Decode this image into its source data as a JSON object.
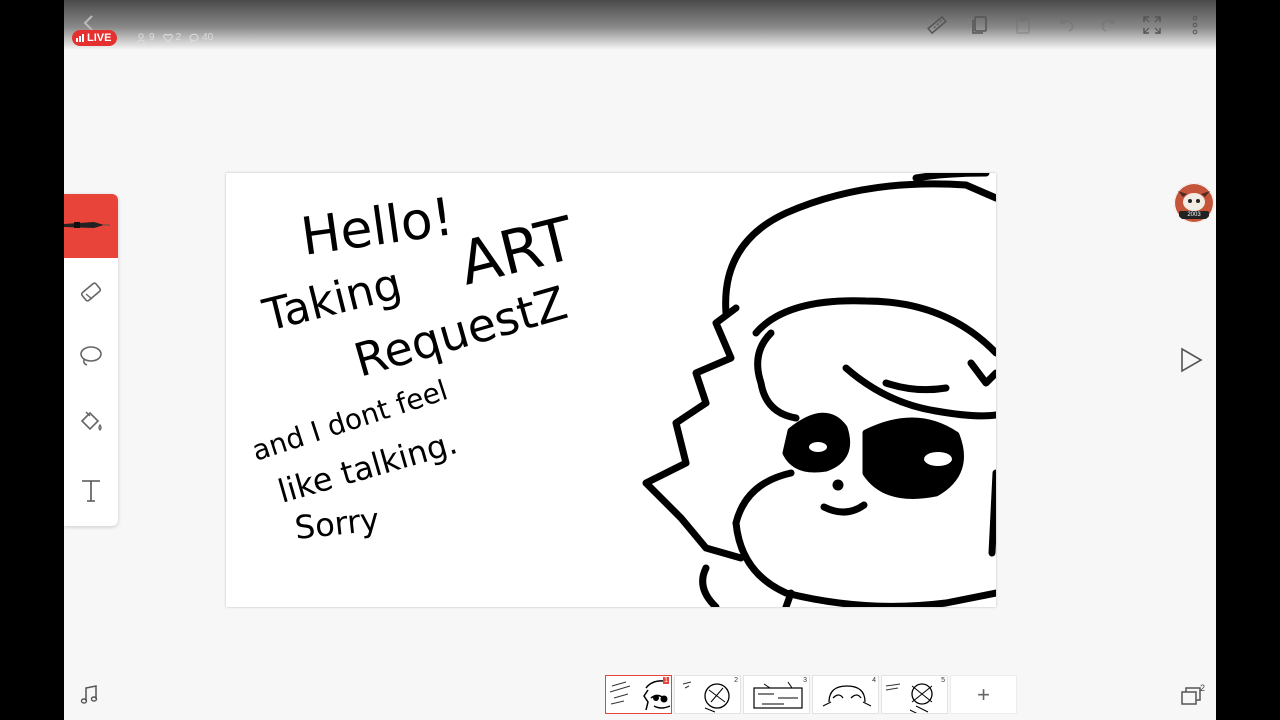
{
  "live": {
    "label": "LIVE",
    "viewers": "9",
    "likes": "2",
    "comments": "40"
  },
  "toolbar": {
    "icons": [
      "ruler-icon",
      "copy-icon",
      "paste-icon",
      "undo-icon",
      "redo-icon",
      "fullscreen-icon",
      "more-icon"
    ]
  },
  "tools": [
    "pen-tool",
    "eraser-tool",
    "lasso-tool",
    "fill-tool",
    "text-tool"
  ],
  "canvas": {
    "line1": "Hello!",
    "line2": "Taking",
    "line3": "ART",
    "line4": "RequestZ",
    "line5": "and I dont feel",
    "line6": "like talking.",
    "line7": "Sorry"
  },
  "avatar": {
    "tag": "2003"
  },
  "frames": [
    {
      "num": "1",
      "active": true
    },
    {
      "num": "2",
      "active": false
    },
    {
      "num": "3",
      "active": false
    },
    {
      "num": "4",
      "active": false
    },
    {
      "num": "5",
      "active": false
    }
  ],
  "add_frame_label": "+",
  "layers": {
    "count": "2"
  },
  "colors": {
    "accent": "#e8443a",
    "live": "#e53030",
    "ink": "#000000",
    "background": "#f7f7f7"
  }
}
